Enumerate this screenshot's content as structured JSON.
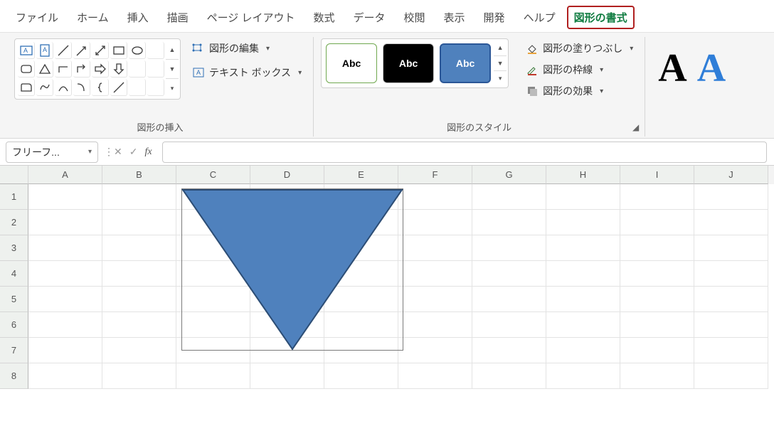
{
  "tabs": {
    "file": "ファイル",
    "home": "ホーム",
    "insert": "挿入",
    "draw": "描画",
    "page_layout": "ページ レイアウト",
    "formulas": "数式",
    "data": "データ",
    "review": "校閲",
    "view": "表示",
    "developer": "開発",
    "help": "ヘルプ",
    "shape_format": "図形の書式"
  },
  "ribbon": {
    "insert_shapes": {
      "label": "図形の挿入",
      "edit_shape": "図形の編集",
      "text_box": "テキスト ボックス"
    },
    "shape_styles": {
      "label": "図形のスタイル",
      "sample": "Abc",
      "fill": "図形の塗りつぶし",
      "outline": "図形の枠線",
      "effects": "図形の効果"
    }
  },
  "namebox": {
    "value": "フリーフ..."
  },
  "formula": {
    "fx": "fx",
    "value": ""
  },
  "columns": [
    "A",
    "B",
    "C",
    "D",
    "E",
    "F",
    "G",
    "H",
    "I",
    "J"
  ],
  "rows": [
    "1",
    "2",
    "3",
    "4",
    "5",
    "6",
    "7",
    "8"
  ]
}
